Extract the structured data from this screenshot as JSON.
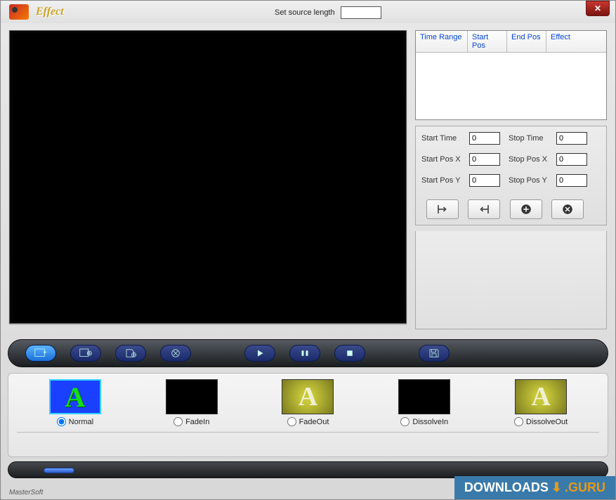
{
  "window": {
    "title": "Effect"
  },
  "source": {
    "label": "Set source length",
    "value": ""
  },
  "table": {
    "columns": {
      "timeRange": "Time Range",
      "startPos": "Start Pos",
      "endPos": "End Pos",
      "effect": "Effect"
    }
  },
  "position": {
    "startTime": {
      "label": "Start Time",
      "value": "0"
    },
    "stopTime": {
      "label": "Stop Time",
      "value": "0"
    },
    "startPosX": {
      "label": "Start Pos X",
      "value": "0"
    },
    "stopPosX": {
      "label": "Stop Pos X",
      "value": "0"
    },
    "startPosY": {
      "label": "Start Pos Y",
      "value": "0"
    },
    "stopPosY": {
      "label": "Stop Pos Y",
      "value": "0"
    }
  },
  "effects": {
    "items": [
      {
        "label": "Normal"
      },
      {
        "label": "FadeIn"
      },
      {
        "label": "FadeOut"
      },
      {
        "label": "DissolveIn"
      },
      {
        "label": "DissolveOut"
      }
    ],
    "glyph": "A"
  },
  "footer": {
    "brand": "MasterSoft"
  },
  "watermark": {
    "pre": "DOWNLOADS",
    "post": ".GURU"
  }
}
